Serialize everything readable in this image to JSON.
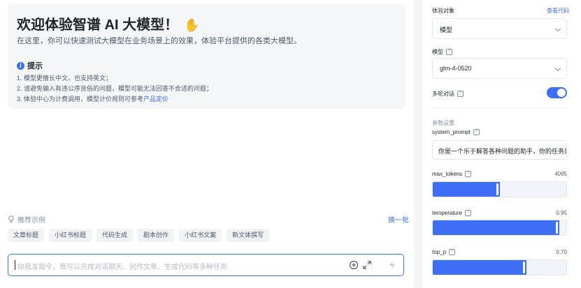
{
  "welcome": {
    "title": "欢迎体验智谱 AI 大模型！",
    "wave_icon": "waving-hand-icon",
    "subtitle": "在这里，你可以快速测试大模型在业务场景上的效果，体验平台提供的各类大模型。",
    "tips_title": "提示",
    "tips": [
      "1. 模型更擅长中文，也支持英文；",
      "2. 请避免输入有违公序良俗的问题，模型可能无法回答不合适的问题；",
      "3. 体验中心为计费调用，模型计价规则可参考"
    ],
    "pricing_link": "产品定价"
  },
  "examples": {
    "title": "推荐示例",
    "refresh": "换一批",
    "chips": [
      "文章标题",
      "小红书标题",
      "代码生成",
      "剧本创作",
      "小红书文案",
      "新文体撰写"
    ]
  },
  "input": {
    "placeholder": "向我发指令，我可以完成对话聊天、创作文章、生成代码等多种任务"
  },
  "panel": {
    "target_label": "体验对象",
    "view_code": "查看代码",
    "target_value": "模型",
    "model_label": "模型",
    "model_value": "glm-4-0520",
    "multi_turn_label": "多轮对话",
    "multi_turn_on": true,
    "params_title": "参数设置",
    "system_prompt_label": "system_prompt",
    "system_prompt_value": "你是一个乐于解答各种问题的助手，你的任务是",
    "max_tokens_label": "max_tokens",
    "max_tokens_value": "4095",
    "max_tokens_fraction": 0.5,
    "temperature_label": "temperature",
    "temperature_value": "0.95",
    "temperature_fraction": 0.95,
    "top_p_label": "top_p",
    "top_p_value": "0.70",
    "top_p_fraction": 0.7
  },
  "colors": {
    "accent": "#3d6ef5",
    "card_bg": "#f5f6f8"
  }
}
